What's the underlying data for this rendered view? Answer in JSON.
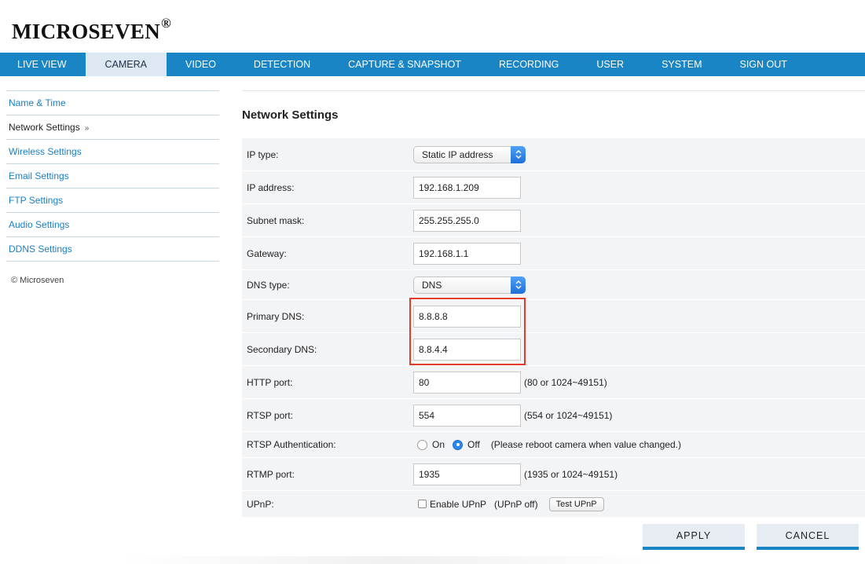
{
  "brand": {
    "name": "MICROSEVEN",
    "mark": "®"
  },
  "nav": {
    "items": [
      {
        "label": "LIVE VIEW"
      },
      {
        "label": "CAMERA"
      },
      {
        "label": "VIDEO"
      },
      {
        "label": "DETECTION"
      },
      {
        "label": "CAPTURE & SNAPSHOT"
      },
      {
        "label": "RECORDING"
      },
      {
        "label": "USER"
      },
      {
        "label": "SYSTEM"
      },
      {
        "label": "SIGN OUT"
      }
    ],
    "active": "CAMERA"
  },
  "sidebar": {
    "items": [
      {
        "label": "Name & Time"
      },
      {
        "label": "Network Settings"
      },
      {
        "label": "Wireless Settings"
      },
      {
        "label": "Email Settings"
      },
      {
        "label": "FTP Settings"
      },
      {
        "label": "Audio Settings"
      },
      {
        "label": "DDNS Settings"
      }
    ],
    "active_arrow": "»",
    "copyright": "© Microseven"
  },
  "page": {
    "title": "Network Settings"
  },
  "form": {
    "ip_type": {
      "label": "IP type:",
      "value": "Static IP address"
    },
    "ip_address": {
      "label": "IP address:",
      "value": "192.168.1.209"
    },
    "subnet_mask": {
      "label": "Subnet mask:",
      "value": "255.255.255.0"
    },
    "gateway": {
      "label": "Gateway:",
      "value": "192.168.1.1"
    },
    "dns_type": {
      "label": "DNS type:",
      "value": "DNS"
    },
    "primary_dns": {
      "label": "Primary DNS:",
      "value": "8.8.8.8"
    },
    "secondary_dns": {
      "label": "Secondary DNS:",
      "value": "8.8.4.4"
    },
    "http_port": {
      "label": "HTTP port:",
      "value": "80",
      "hint": "(80 or 1024~49151)"
    },
    "rtsp_port": {
      "label": "RTSP port:",
      "value": "554",
      "hint": "(554 or 1024~49151)"
    },
    "rtsp_auth": {
      "label": "RTSP Authentication:",
      "on_label": "On",
      "off_label": "Off",
      "selected": "Off",
      "hint": "(Please reboot camera when value changed.)"
    },
    "rtmp_port": {
      "label": "RTMP port:",
      "value": "1935",
      "hint": "(1935 or 1024~49151)"
    },
    "upnp": {
      "label": "UPnP:",
      "checkbox_label": "Enable UPnP",
      "checked": false,
      "status": "(UPnP off)",
      "test_button": "Test UPnP"
    }
  },
  "actions": {
    "apply": "APPLY",
    "cancel": "CANCEL"
  },
  "colors": {
    "nav_bg": "#1a85c5",
    "nav_active_bg": "#dde8f2",
    "link": "#1a7fc0",
    "highlight": "#e23b2a",
    "form_bg": "#f3f4f6"
  }
}
